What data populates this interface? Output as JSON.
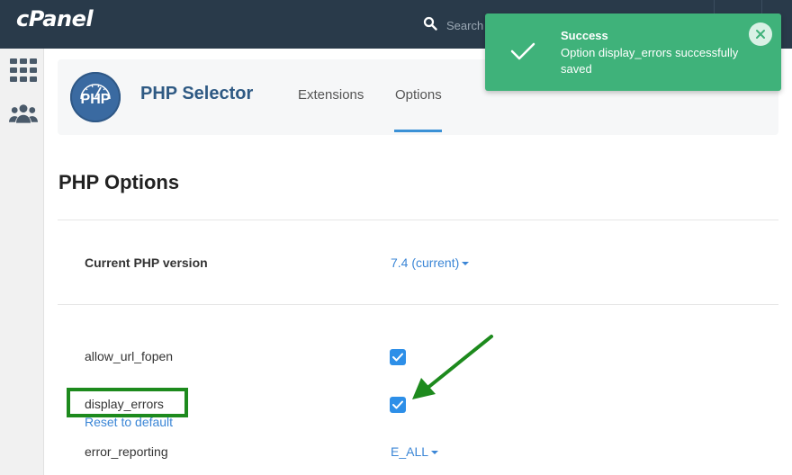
{
  "topbar": {
    "logo": "cPanel",
    "search_placeholder": "Search"
  },
  "rail": {
    "icons": [
      "grid-icon",
      "users-icon"
    ]
  },
  "header": {
    "title": "PHP Selector",
    "logo_text": "PHP",
    "tabs": [
      {
        "label": "Extensions",
        "active": false
      },
      {
        "label": "Options",
        "active": true
      }
    ]
  },
  "main": {
    "page_title": "PHP Options",
    "php_version": {
      "label": "Current PHP version",
      "value": "7.4 (current)"
    },
    "options": [
      {
        "name": "allow_url_fopen",
        "checked": true
      },
      {
        "name": "display_errors",
        "checked": true,
        "reset_label": "Reset to default"
      },
      {
        "name": "error_reporting",
        "value": "E_ALL"
      }
    ]
  },
  "toast": {
    "title": "Success",
    "message": "Option display_errors successfully saved"
  },
  "colors": {
    "topbar": "#293a4a",
    "accent": "#3b86d6",
    "toast": "#3fb27a",
    "highlight": "#1d8a1d"
  }
}
